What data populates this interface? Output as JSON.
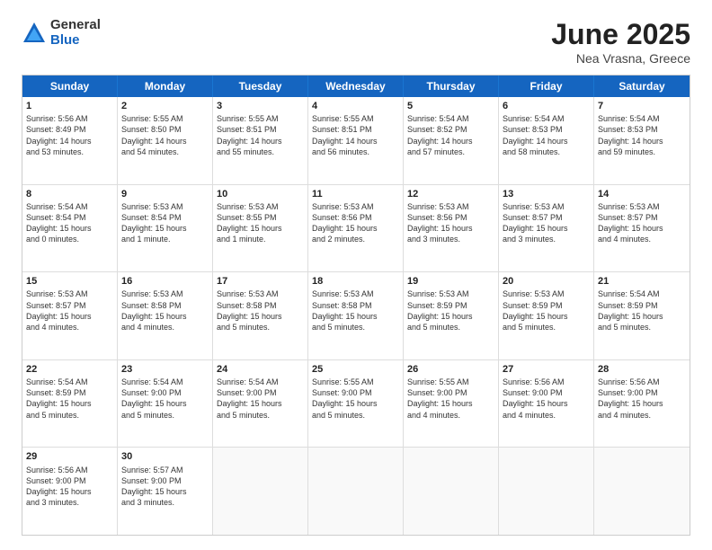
{
  "logo": {
    "general": "General",
    "blue": "Blue"
  },
  "title": {
    "month": "June 2025",
    "location": "Nea Vrasna, Greece"
  },
  "header_days": [
    "Sunday",
    "Monday",
    "Tuesday",
    "Wednesday",
    "Thursday",
    "Friday",
    "Saturday"
  ],
  "rows": [
    [
      {
        "day": "1",
        "lines": [
          "Sunrise: 5:56 AM",
          "Sunset: 8:49 PM",
          "Daylight: 14 hours",
          "and 53 minutes."
        ]
      },
      {
        "day": "2",
        "lines": [
          "Sunrise: 5:55 AM",
          "Sunset: 8:50 PM",
          "Daylight: 14 hours",
          "and 54 minutes."
        ]
      },
      {
        "day": "3",
        "lines": [
          "Sunrise: 5:55 AM",
          "Sunset: 8:51 PM",
          "Daylight: 14 hours",
          "and 55 minutes."
        ]
      },
      {
        "day": "4",
        "lines": [
          "Sunrise: 5:55 AM",
          "Sunset: 8:51 PM",
          "Daylight: 14 hours",
          "and 56 minutes."
        ]
      },
      {
        "day": "5",
        "lines": [
          "Sunrise: 5:54 AM",
          "Sunset: 8:52 PM",
          "Daylight: 14 hours",
          "and 57 minutes."
        ]
      },
      {
        "day": "6",
        "lines": [
          "Sunrise: 5:54 AM",
          "Sunset: 8:53 PM",
          "Daylight: 14 hours",
          "and 58 minutes."
        ]
      },
      {
        "day": "7",
        "lines": [
          "Sunrise: 5:54 AM",
          "Sunset: 8:53 PM",
          "Daylight: 14 hours",
          "and 59 minutes."
        ]
      }
    ],
    [
      {
        "day": "8",
        "lines": [
          "Sunrise: 5:54 AM",
          "Sunset: 8:54 PM",
          "Daylight: 15 hours",
          "and 0 minutes."
        ]
      },
      {
        "day": "9",
        "lines": [
          "Sunrise: 5:53 AM",
          "Sunset: 8:54 PM",
          "Daylight: 15 hours",
          "and 1 minute."
        ]
      },
      {
        "day": "10",
        "lines": [
          "Sunrise: 5:53 AM",
          "Sunset: 8:55 PM",
          "Daylight: 15 hours",
          "and 1 minute."
        ]
      },
      {
        "day": "11",
        "lines": [
          "Sunrise: 5:53 AM",
          "Sunset: 8:56 PM",
          "Daylight: 15 hours",
          "and 2 minutes."
        ]
      },
      {
        "day": "12",
        "lines": [
          "Sunrise: 5:53 AM",
          "Sunset: 8:56 PM",
          "Daylight: 15 hours",
          "and 3 minutes."
        ]
      },
      {
        "day": "13",
        "lines": [
          "Sunrise: 5:53 AM",
          "Sunset: 8:57 PM",
          "Daylight: 15 hours",
          "and 3 minutes."
        ]
      },
      {
        "day": "14",
        "lines": [
          "Sunrise: 5:53 AM",
          "Sunset: 8:57 PM",
          "Daylight: 15 hours",
          "and 4 minutes."
        ]
      }
    ],
    [
      {
        "day": "15",
        "lines": [
          "Sunrise: 5:53 AM",
          "Sunset: 8:57 PM",
          "Daylight: 15 hours",
          "and 4 minutes."
        ]
      },
      {
        "day": "16",
        "lines": [
          "Sunrise: 5:53 AM",
          "Sunset: 8:58 PM",
          "Daylight: 15 hours",
          "and 4 minutes."
        ]
      },
      {
        "day": "17",
        "lines": [
          "Sunrise: 5:53 AM",
          "Sunset: 8:58 PM",
          "Daylight: 15 hours",
          "and 5 minutes."
        ]
      },
      {
        "day": "18",
        "lines": [
          "Sunrise: 5:53 AM",
          "Sunset: 8:58 PM",
          "Daylight: 15 hours",
          "and 5 minutes."
        ]
      },
      {
        "day": "19",
        "lines": [
          "Sunrise: 5:53 AM",
          "Sunset: 8:59 PM",
          "Daylight: 15 hours",
          "and 5 minutes."
        ]
      },
      {
        "day": "20",
        "lines": [
          "Sunrise: 5:53 AM",
          "Sunset: 8:59 PM",
          "Daylight: 15 hours",
          "and 5 minutes."
        ]
      },
      {
        "day": "21",
        "lines": [
          "Sunrise: 5:54 AM",
          "Sunset: 8:59 PM",
          "Daylight: 15 hours",
          "and 5 minutes."
        ]
      }
    ],
    [
      {
        "day": "22",
        "lines": [
          "Sunrise: 5:54 AM",
          "Sunset: 8:59 PM",
          "Daylight: 15 hours",
          "and 5 minutes."
        ]
      },
      {
        "day": "23",
        "lines": [
          "Sunrise: 5:54 AM",
          "Sunset: 9:00 PM",
          "Daylight: 15 hours",
          "and 5 minutes."
        ]
      },
      {
        "day": "24",
        "lines": [
          "Sunrise: 5:54 AM",
          "Sunset: 9:00 PM",
          "Daylight: 15 hours",
          "and 5 minutes."
        ]
      },
      {
        "day": "25",
        "lines": [
          "Sunrise: 5:55 AM",
          "Sunset: 9:00 PM",
          "Daylight: 15 hours",
          "and 5 minutes."
        ]
      },
      {
        "day": "26",
        "lines": [
          "Sunrise: 5:55 AM",
          "Sunset: 9:00 PM",
          "Daylight: 15 hours",
          "and 4 minutes."
        ]
      },
      {
        "day": "27",
        "lines": [
          "Sunrise: 5:56 AM",
          "Sunset: 9:00 PM",
          "Daylight: 15 hours",
          "and 4 minutes."
        ]
      },
      {
        "day": "28",
        "lines": [
          "Sunrise: 5:56 AM",
          "Sunset: 9:00 PM",
          "Daylight: 15 hours",
          "and 4 minutes."
        ]
      }
    ],
    [
      {
        "day": "29",
        "lines": [
          "Sunrise: 5:56 AM",
          "Sunset: 9:00 PM",
          "Daylight: 15 hours",
          "and 3 minutes."
        ]
      },
      {
        "day": "30",
        "lines": [
          "Sunrise: 5:57 AM",
          "Sunset: 9:00 PM",
          "Daylight: 15 hours",
          "and 3 minutes."
        ]
      },
      {
        "day": "",
        "lines": []
      },
      {
        "day": "",
        "lines": []
      },
      {
        "day": "",
        "lines": []
      },
      {
        "day": "",
        "lines": []
      },
      {
        "day": "",
        "lines": []
      }
    ]
  ]
}
